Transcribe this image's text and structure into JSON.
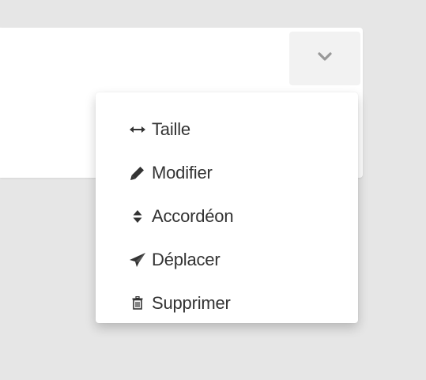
{
  "toggle": {
    "icon": "chevron-down-icon"
  },
  "menu": {
    "items": [
      {
        "label": "Taille",
        "icon": "arrows-horizontal-icon"
      },
      {
        "label": "Modifier",
        "icon": "pencil-icon"
      },
      {
        "label": "Accordéon",
        "icon": "sort-icon"
      },
      {
        "label": "Déplacer",
        "icon": "paper-plane-icon"
      },
      {
        "label": "Supprimer",
        "icon": "trash-icon"
      }
    ]
  },
  "colors": {
    "background": "#e6e6e6",
    "panel": "#ffffff",
    "button": "#f2f2f2",
    "text": "#333333",
    "icon": "#333333",
    "chevron": "#999999"
  }
}
